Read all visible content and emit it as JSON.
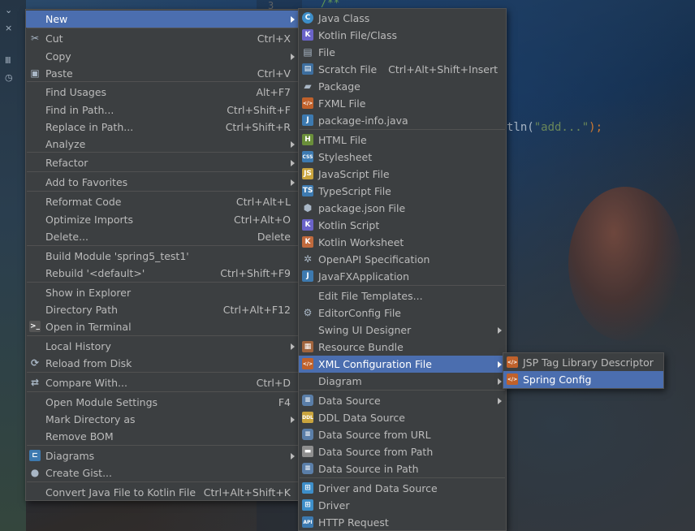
{
  "editor": {
    "line_number": "3",
    "comment": "/**",
    "code_call": "tln(",
    "code_string": "\"add...\"",
    "code_end": ");"
  },
  "main_menu": [
    {
      "label": "New",
      "shortcut": "",
      "submenu": true,
      "icon": "",
      "selected": true
    },
    {
      "label": "Cut",
      "shortcut": "Ctrl+X",
      "icon": "cut-icon"
    },
    {
      "label": "Copy",
      "shortcut": "",
      "submenu": true
    },
    {
      "label": "Paste",
      "shortcut": "Ctrl+V",
      "icon": "paste-icon"
    },
    {
      "label": "Find Usages",
      "shortcut": "Alt+F7"
    },
    {
      "label": "Find in Path...",
      "shortcut": "Ctrl+Shift+F"
    },
    {
      "label": "Replace in Path...",
      "shortcut": "Ctrl+Shift+R"
    },
    {
      "label": "Analyze",
      "shortcut": "",
      "submenu": true
    },
    {
      "label": "Refactor",
      "shortcut": "",
      "submenu": true
    },
    {
      "label": "Add to Favorites",
      "shortcut": "",
      "submenu": true
    },
    {
      "label": "Reformat Code",
      "shortcut": "Ctrl+Alt+L"
    },
    {
      "label": "Optimize Imports",
      "shortcut": "Ctrl+Alt+O"
    },
    {
      "label": "Delete...",
      "shortcut": "Delete"
    },
    {
      "label": "Build Module 'spring5_test1'",
      "shortcut": ""
    },
    {
      "label": "Rebuild '<default>'",
      "shortcut": "Ctrl+Shift+F9"
    },
    {
      "label": "Show in Explorer",
      "shortcut": ""
    },
    {
      "label": "Directory Path",
      "shortcut": "Ctrl+Alt+F12"
    },
    {
      "label": "Open in Terminal",
      "shortcut": "",
      "icon": "terminal-icon"
    },
    {
      "label": "Local History",
      "shortcut": "",
      "submenu": true
    },
    {
      "label": "Reload from Disk",
      "shortcut": "",
      "icon": "reload-icon"
    },
    {
      "label": "Compare With...",
      "shortcut": "Ctrl+D",
      "icon": "compare-icon"
    },
    {
      "label": "Open Module Settings",
      "shortcut": "F4"
    },
    {
      "label": "Mark Directory as",
      "shortcut": "",
      "submenu": true
    },
    {
      "label": "Remove BOM",
      "shortcut": ""
    },
    {
      "label": "Diagrams",
      "shortcut": "",
      "submenu": true,
      "icon": "diagram-icon"
    },
    {
      "label": "Create Gist...",
      "shortcut": "",
      "icon": "github-icon"
    },
    {
      "label": "Convert Java File to Kotlin File",
      "shortcut": "Ctrl+Alt+Shift+K"
    }
  ],
  "new_menu": [
    {
      "label": "Java Class",
      "icon": "java-class-icon"
    },
    {
      "label": "Kotlin File/Class",
      "icon": "kotlin-icon"
    },
    {
      "label": "File",
      "icon": "file-icon"
    },
    {
      "label": "Scratch File",
      "shortcut": "Ctrl+Alt+Shift+Insert",
      "icon": "scratch-file-icon"
    },
    {
      "label": "Package",
      "icon": "package-icon"
    },
    {
      "label": "FXML File",
      "icon": "fxml-icon"
    },
    {
      "label": "package-info.java",
      "icon": "java-file-icon"
    },
    {
      "label": "HTML File",
      "icon": "html-icon"
    },
    {
      "label": "Stylesheet",
      "icon": "css-icon"
    },
    {
      "label": "JavaScript File",
      "icon": "js-icon"
    },
    {
      "label": "TypeScript File",
      "icon": "ts-icon"
    },
    {
      "label": "package.json File",
      "icon": "nodejs-icon"
    },
    {
      "label": "Kotlin Script",
      "icon": "kotlin-script-icon"
    },
    {
      "label": "Kotlin Worksheet",
      "icon": "kotlin-worksheet-icon"
    },
    {
      "label": "OpenAPI Specification",
      "icon": "openapi-icon"
    },
    {
      "label": "JavaFXApplication",
      "icon": "javafx-icon"
    },
    {
      "label": "Edit File Templates...",
      "icon": ""
    },
    {
      "label": "EditorConfig File",
      "icon": "gear-icon"
    },
    {
      "label": "Swing UI Designer",
      "icon": "",
      "submenu": true
    },
    {
      "label": "Resource Bundle",
      "icon": "resource-bundle-icon"
    },
    {
      "label": "XML Configuration File",
      "icon": "xml-icon",
      "submenu": true,
      "selected": true
    },
    {
      "label": "Diagram",
      "icon": "",
      "submenu": true
    },
    {
      "label": "Data Source",
      "icon": "database-icon",
      "submenu": true
    },
    {
      "label": "DDL Data Source",
      "icon": "ddl-icon"
    },
    {
      "label": "Data Source from URL",
      "icon": "database-icon"
    },
    {
      "label": "Data Source from Path",
      "icon": "folder-icon"
    },
    {
      "label": "Data Source in Path",
      "icon": "database-icon"
    },
    {
      "label": "Driver and Data Source",
      "icon": "driver-icon"
    },
    {
      "label": "Driver",
      "icon": "driver-icon"
    },
    {
      "label": "HTTP Request",
      "icon": "api-icon"
    }
  ],
  "xml_menu": [
    {
      "label": "JSP Tag Library Descriptor",
      "icon": "jsp-tag-icon"
    },
    {
      "label": "Spring Config",
      "icon": "spring-icon",
      "selected": true
    }
  ],
  "colors": {
    "menu_bg": "#3c3f41",
    "selection": "#4b6eaf",
    "separator": "#515151",
    "text": "#bbbbbb"
  }
}
